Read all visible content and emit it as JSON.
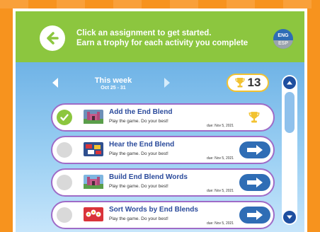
{
  "header": {
    "line1": "Click an assignment to get started.",
    "line2": "Earn a trophy for each activity you complete",
    "lang_primary": "ENG",
    "lang_secondary": "ESP"
  },
  "week": {
    "title": "This week",
    "range": "Oct 25 - 31"
  },
  "trophies": {
    "count": "13"
  },
  "assignments": [
    {
      "title": "Add the End Blend",
      "description": "Play the game. Do your best!",
      "due": "due: Nov 5, 2021",
      "completed": true,
      "thumb_color": "#6d8fb8",
      "icon": "trophy-icon"
    },
    {
      "title": "Hear the End Blend",
      "description": "Play the game. Do your best!",
      "due": "due: Nov 5, 2021",
      "completed": false,
      "thumb_color": "#2f4f8f",
      "icon": "arrow-right-icon"
    },
    {
      "title": "Build End Blend Words",
      "description": "Play the game. Do your best!",
      "due": "due: Nov 5, 2021",
      "completed": false,
      "thumb_color": "#5a9e4a",
      "icon": "arrow-right-icon"
    },
    {
      "title": "Sort Words by End Blends",
      "description": "Play the game. Do your best!",
      "due": "due: Nov 5, 2021",
      "completed": false,
      "thumb_color": "#d9343a",
      "icon": "arrow-right-icon"
    }
  ],
  "colors": {
    "header_bg": "#8cc63f",
    "frame_orange": "#f7931e",
    "row_border": "#9f6bc7",
    "title_blue": "#2a4a9b",
    "button_blue": "#2f6db5",
    "trophy_gold": "#f2c230"
  }
}
